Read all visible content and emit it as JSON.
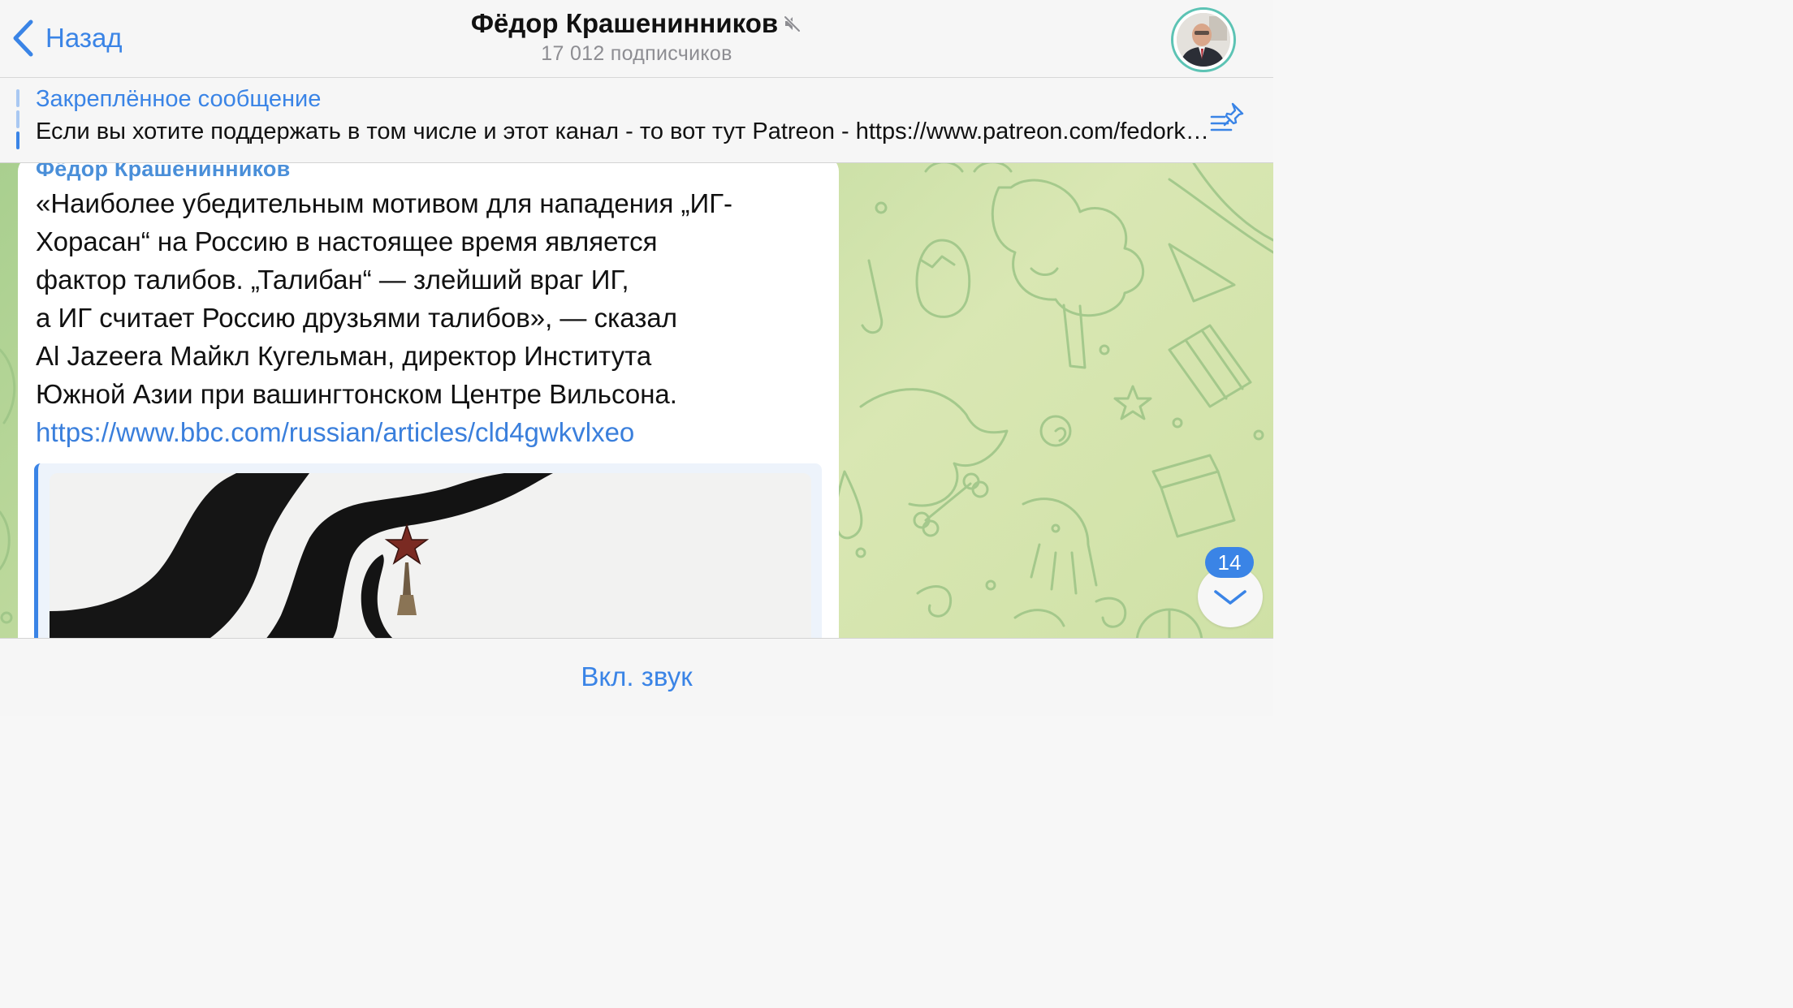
{
  "header": {
    "back_label": "Назад",
    "title": "Фёдор Крашенинников",
    "subtitle": "17 012 подписчиков"
  },
  "pinned": {
    "title": "Закреплённое сообщение",
    "text": "Если вы хотите поддержать в том числе и этот канал - то вот тут Patreon - https://www.patreon.com/fedorkrasheninnikov"
  },
  "message": {
    "author": "Фёдор Крашенинников",
    "lines": [
      "«Наиболее убедительным мотивом для нападения „ИГ-",
      "Хорасан“ на Россию в настоящее время является",
      "фактор талибов. „Талибан“ — злейший враг ИГ,",
      "а ИГ считает Россию друзьями талибов», — сказал",
      "Al Jazeera Майкл Кугельман, директор Института",
      "Южной Азии при вашингтонском Центре Вильсона."
    ],
    "link": "https://www.bbc.com/russian/articles/cld4gwkvlxeo"
  },
  "scroll": {
    "unread_count": "14"
  },
  "bottom": {
    "unmute_label": "Вкл. звук"
  },
  "icons": {
    "back": "chevron-left-icon",
    "muted": "speaker-muted-icon",
    "pin_list": "pin-list-icon",
    "scroll_down": "chevron-down-icon"
  },
  "colors": {
    "accent": "#3a84e6",
    "author": "#4a8fd9",
    "wallpaper": "#c3dca0",
    "text": "#111111",
    "secondary": "#8d8d92"
  }
}
